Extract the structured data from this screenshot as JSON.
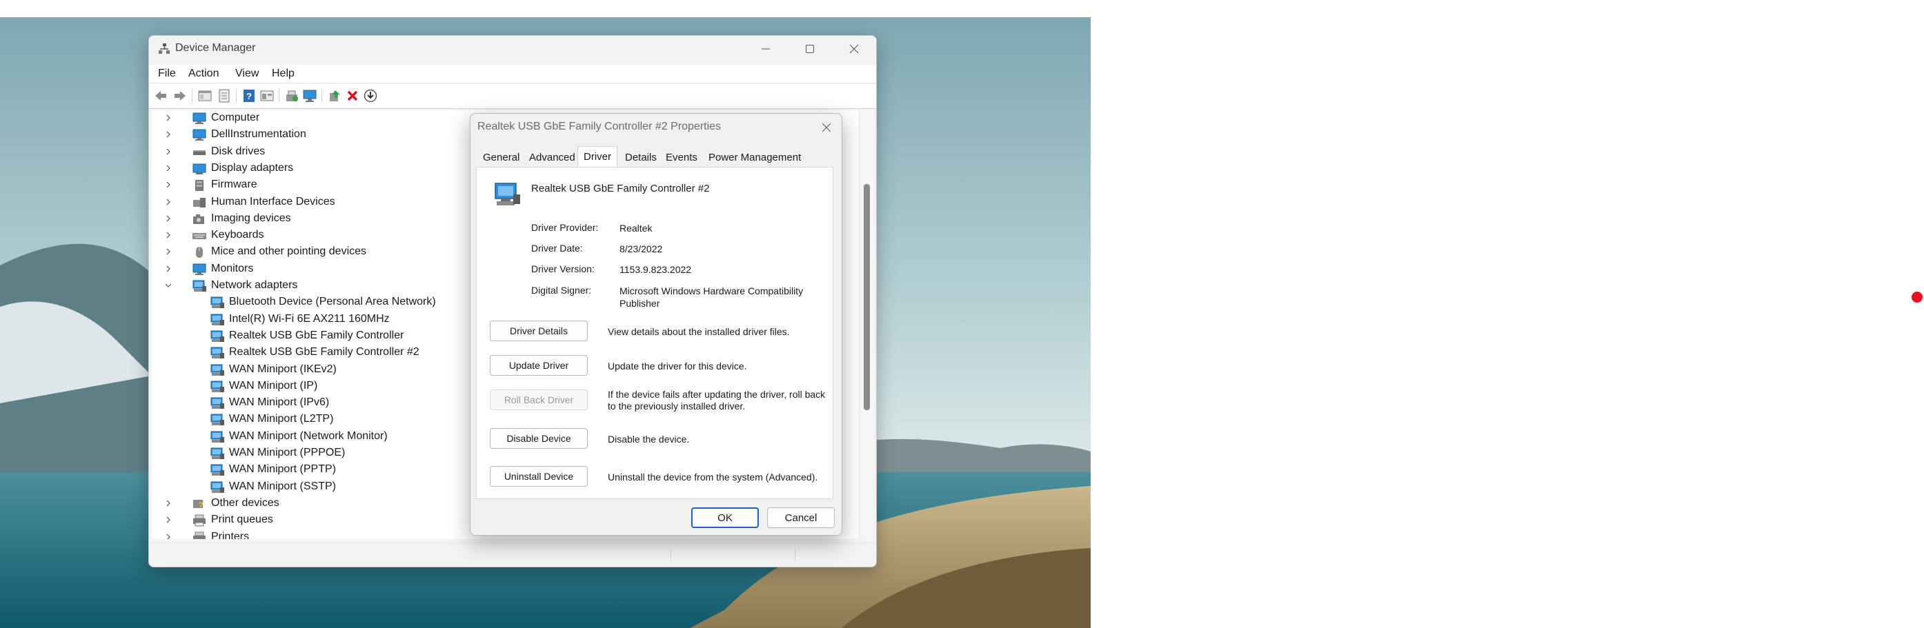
{
  "window": {
    "title": "Device Manager",
    "menu": [
      "File",
      "Action",
      "View",
      "Help"
    ]
  },
  "toolbar_icons": [
    "back-arrow-icon",
    "forward-arrow-icon",
    "show-hide-tree-icon",
    "properties-icon",
    "help-icon",
    "view-resources-icon",
    "update-driver-icon",
    "scan-hardware-icon",
    "enable-device-icon",
    "uninstall-device-icon",
    "download-driver-icon"
  ],
  "tree": [
    {
      "label": "Computer",
      "state": "collapsed",
      "icon": "monitor-icon"
    },
    {
      "label": "DellInstrumentation",
      "state": "collapsed",
      "icon": "monitor-icon"
    },
    {
      "label": "Disk drives",
      "state": "collapsed",
      "icon": "disk-drive-icon"
    },
    {
      "label": "Display adapters",
      "state": "collapsed",
      "icon": "display-adapter-icon"
    },
    {
      "label": "Firmware",
      "state": "collapsed",
      "icon": "firmware-icon"
    },
    {
      "label": "Human Interface Devices",
      "state": "collapsed",
      "icon": "hid-icon"
    },
    {
      "label": "Imaging devices",
      "state": "collapsed",
      "icon": "camera-icon"
    },
    {
      "label": "Keyboards",
      "state": "collapsed",
      "icon": "keyboard-icon"
    },
    {
      "label": "Mice and other pointing devices",
      "state": "collapsed",
      "icon": "mouse-icon"
    },
    {
      "label": "Monitors",
      "state": "collapsed",
      "icon": "monitor-icon"
    },
    {
      "label": "Network adapters",
      "state": "expanded",
      "icon": "network-adapter-icon"
    },
    {
      "label": "Bluetooth Device (Personal Area Network)",
      "state": "child",
      "icon": "network-adapter-icon"
    },
    {
      "label": "Intel(R) Wi-Fi 6E AX211 160MHz",
      "state": "child",
      "icon": "network-adapter-icon"
    },
    {
      "label": "Realtek USB GbE Family Controller",
      "state": "child",
      "icon": "network-adapter-icon"
    },
    {
      "label": "Realtek USB GbE Family Controller #2",
      "state": "child",
      "icon": "network-adapter-icon"
    },
    {
      "label": "WAN Miniport (IKEv2)",
      "state": "child",
      "icon": "network-adapter-icon"
    },
    {
      "label": "WAN Miniport (IP)",
      "state": "child",
      "icon": "network-adapter-icon"
    },
    {
      "label": "WAN Miniport (IPv6)",
      "state": "child",
      "icon": "network-adapter-icon"
    },
    {
      "label": "WAN Miniport (L2TP)",
      "state": "child",
      "icon": "network-adapter-icon"
    },
    {
      "label": "WAN Miniport (Network Monitor)",
      "state": "child",
      "icon": "network-adapter-icon"
    },
    {
      "label": "WAN Miniport (PPPOE)",
      "state": "child",
      "icon": "network-adapter-icon"
    },
    {
      "label": "WAN Miniport (PPTP)",
      "state": "child",
      "icon": "network-adapter-icon"
    },
    {
      "label": "WAN Miniport (SSTP)",
      "state": "child",
      "icon": "network-adapter-icon"
    },
    {
      "label": "Other devices",
      "state": "collapsed",
      "icon": "other-devices-icon"
    },
    {
      "label": "Print queues",
      "state": "collapsed",
      "icon": "printer-icon"
    },
    {
      "label": "Printers",
      "state": "collapsed",
      "icon": "printer-icon"
    }
  ],
  "dialog": {
    "title": "Realtek USB GbE Family Controller #2 Properties",
    "tabs": [
      "General",
      "Advanced",
      "Driver",
      "Details",
      "Events",
      "Power Management"
    ],
    "active_tab": "Driver",
    "device_name": "Realtek USB GbE Family Controller #2",
    "info": {
      "provider_label": "Driver Provider:",
      "provider": "Realtek",
      "date_label": "Driver Date:",
      "date": "8/23/2022",
      "version_label": "Driver Version:",
      "version": "1153.9.823.2022",
      "signer_label": "Digital Signer:",
      "signer": "Microsoft Windows Hardware Compatibility Publisher"
    },
    "actions": [
      {
        "label": "Driver Details",
        "desc": "View details about the installed driver files.",
        "enabled": true
      },
      {
        "label": "Update Driver",
        "desc": "Update the driver for this device.",
        "enabled": true
      },
      {
        "label": "Roll Back Driver",
        "desc": "If the device fails after updating the driver, roll back to the previously installed driver.",
        "enabled": false
      },
      {
        "label": "Disable Device",
        "desc": "Disable the device.",
        "enabled": true
      },
      {
        "label": "Uninstall Device",
        "desc": "Uninstall the device from the system (Advanced).",
        "enabled": true
      }
    ],
    "ok_label": "OK",
    "cancel_label": "Cancel"
  },
  "colors": {
    "accent": "#1f5fbf",
    "network_icon": "#2f8fd8",
    "close_red": "#cc1a1a",
    "marker_red": "#e81123"
  }
}
